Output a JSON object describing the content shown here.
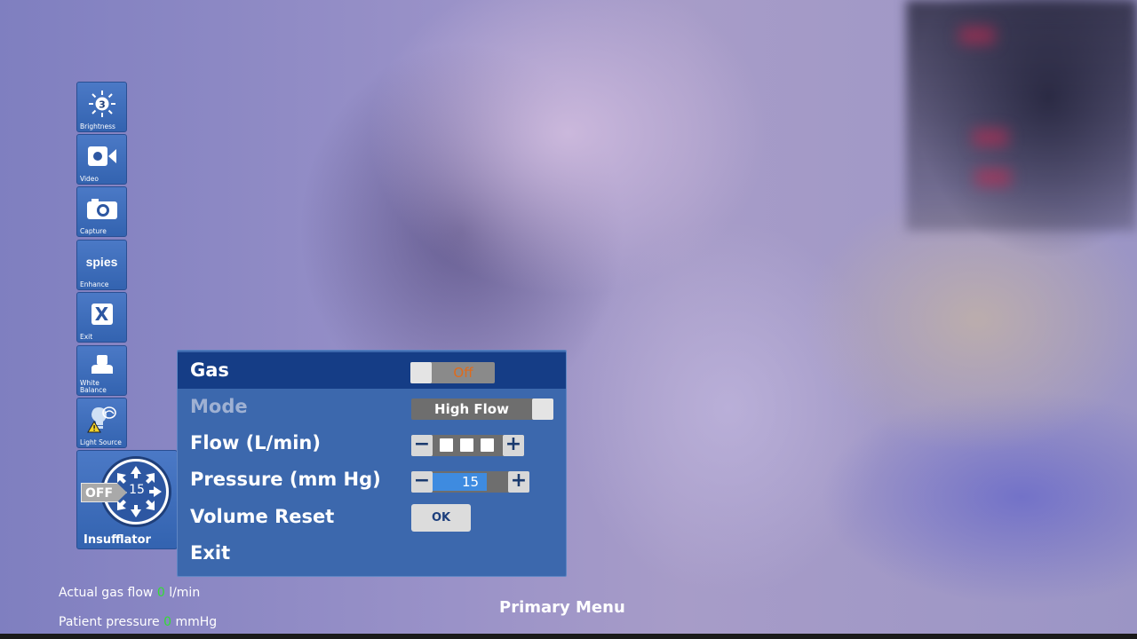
{
  "toolbar": {
    "items": [
      {
        "label": "Brightness",
        "icon": "brightness-icon",
        "level": "3"
      },
      {
        "label": "Video",
        "icon": "video-camera-icon"
      },
      {
        "label": "Capture",
        "icon": "camera-icon"
      },
      {
        "label": "Enhance",
        "icon": "spies-icon",
        "logo_text": "spies"
      },
      {
        "label": "Exit",
        "icon": "close-icon",
        "glyph": "X"
      },
      {
        "label": "White\nBalance",
        "label_line1": "White",
        "label_line2": "Balance",
        "icon": "white-balance-icon"
      },
      {
        "label": "Light Source",
        "icon": "light-source-icon"
      }
    ]
  },
  "insufflator": {
    "state": "OFF",
    "pressure": "15",
    "label": "Insufflator"
  },
  "menu": {
    "gas": {
      "label": "Gas",
      "value": "Off"
    },
    "mode": {
      "label": "Mode",
      "value": "High Flow"
    },
    "flow": {
      "label": "Flow (L/min)",
      "level_segments": 3,
      "minus": "−",
      "plus": "+"
    },
    "pressure": {
      "label": "Pressure (mm Hg)",
      "value": "15",
      "fill_fraction": 0.72,
      "minus": "−",
      "plus": "+"
    },
    "volume_reset": {
      "label": "Volume Reset",
      "button": "OK"
    },
    "exit": {
      "label": "Exit"
    }
  },
  "status": {
    "gas_flow_label": "Actual gas flow",
    "gas_flow_value": "0",
    "gas_flow_unit": "l/min",
    "patient_pressure_label": "Patient pressure",
    "patient_pressure_value": "0",
    "patient_pressure_unit": "mmHg"
  },
  "footer": {
    "title": "Primary Menu"
  },
  "colors": {
    "panel": "#3c68ad",
    "selected_row": "#153d86",
    "off_text": "#e06a1a",
    "status_value": "#33dd33",
    "fill": "#3e8be0"
  }
}
